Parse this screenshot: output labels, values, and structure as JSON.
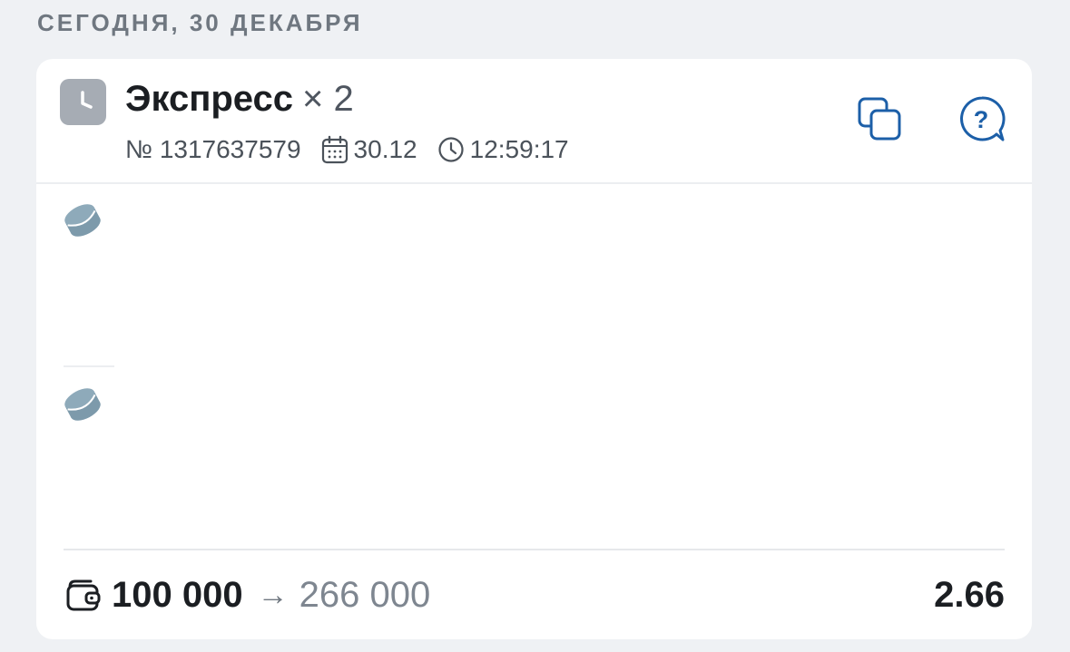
{
  "date_header": "СЕГОДНЯ, 30 ДЕКАБРЯ",
  "bet": {
    "status_icon": "clock-icon",
    "title": "Экспресс",
    "multiplier": "× 2",
    "number": "№ 1317637579",
    "date": "30.12",
    "time": "12:59:17",
    "actions": {
      "copy_icon": "copy-icon",
      "help_icon": "help-chat-icon"
    },
    "events": [
      {
        "icon": "hockey-puck-icon"
      },
      {
        "icon": "hockey-puck-icon"
      }
    ],
    "footer": {
      "wallet_icon": "wallet-icon",
      "stake": "100 000",
      "arrow": "→",
      "potential_win": "266 000",
      "coefficient": "2.66"
    }
  },
  "colors": {
    "background": "#eff1f4",
    "card": "#ffffff",
    "accent": "#1c5fa8",
    "muted": "#7e8690",
    "puck": "#7d9aab"
  }
}
